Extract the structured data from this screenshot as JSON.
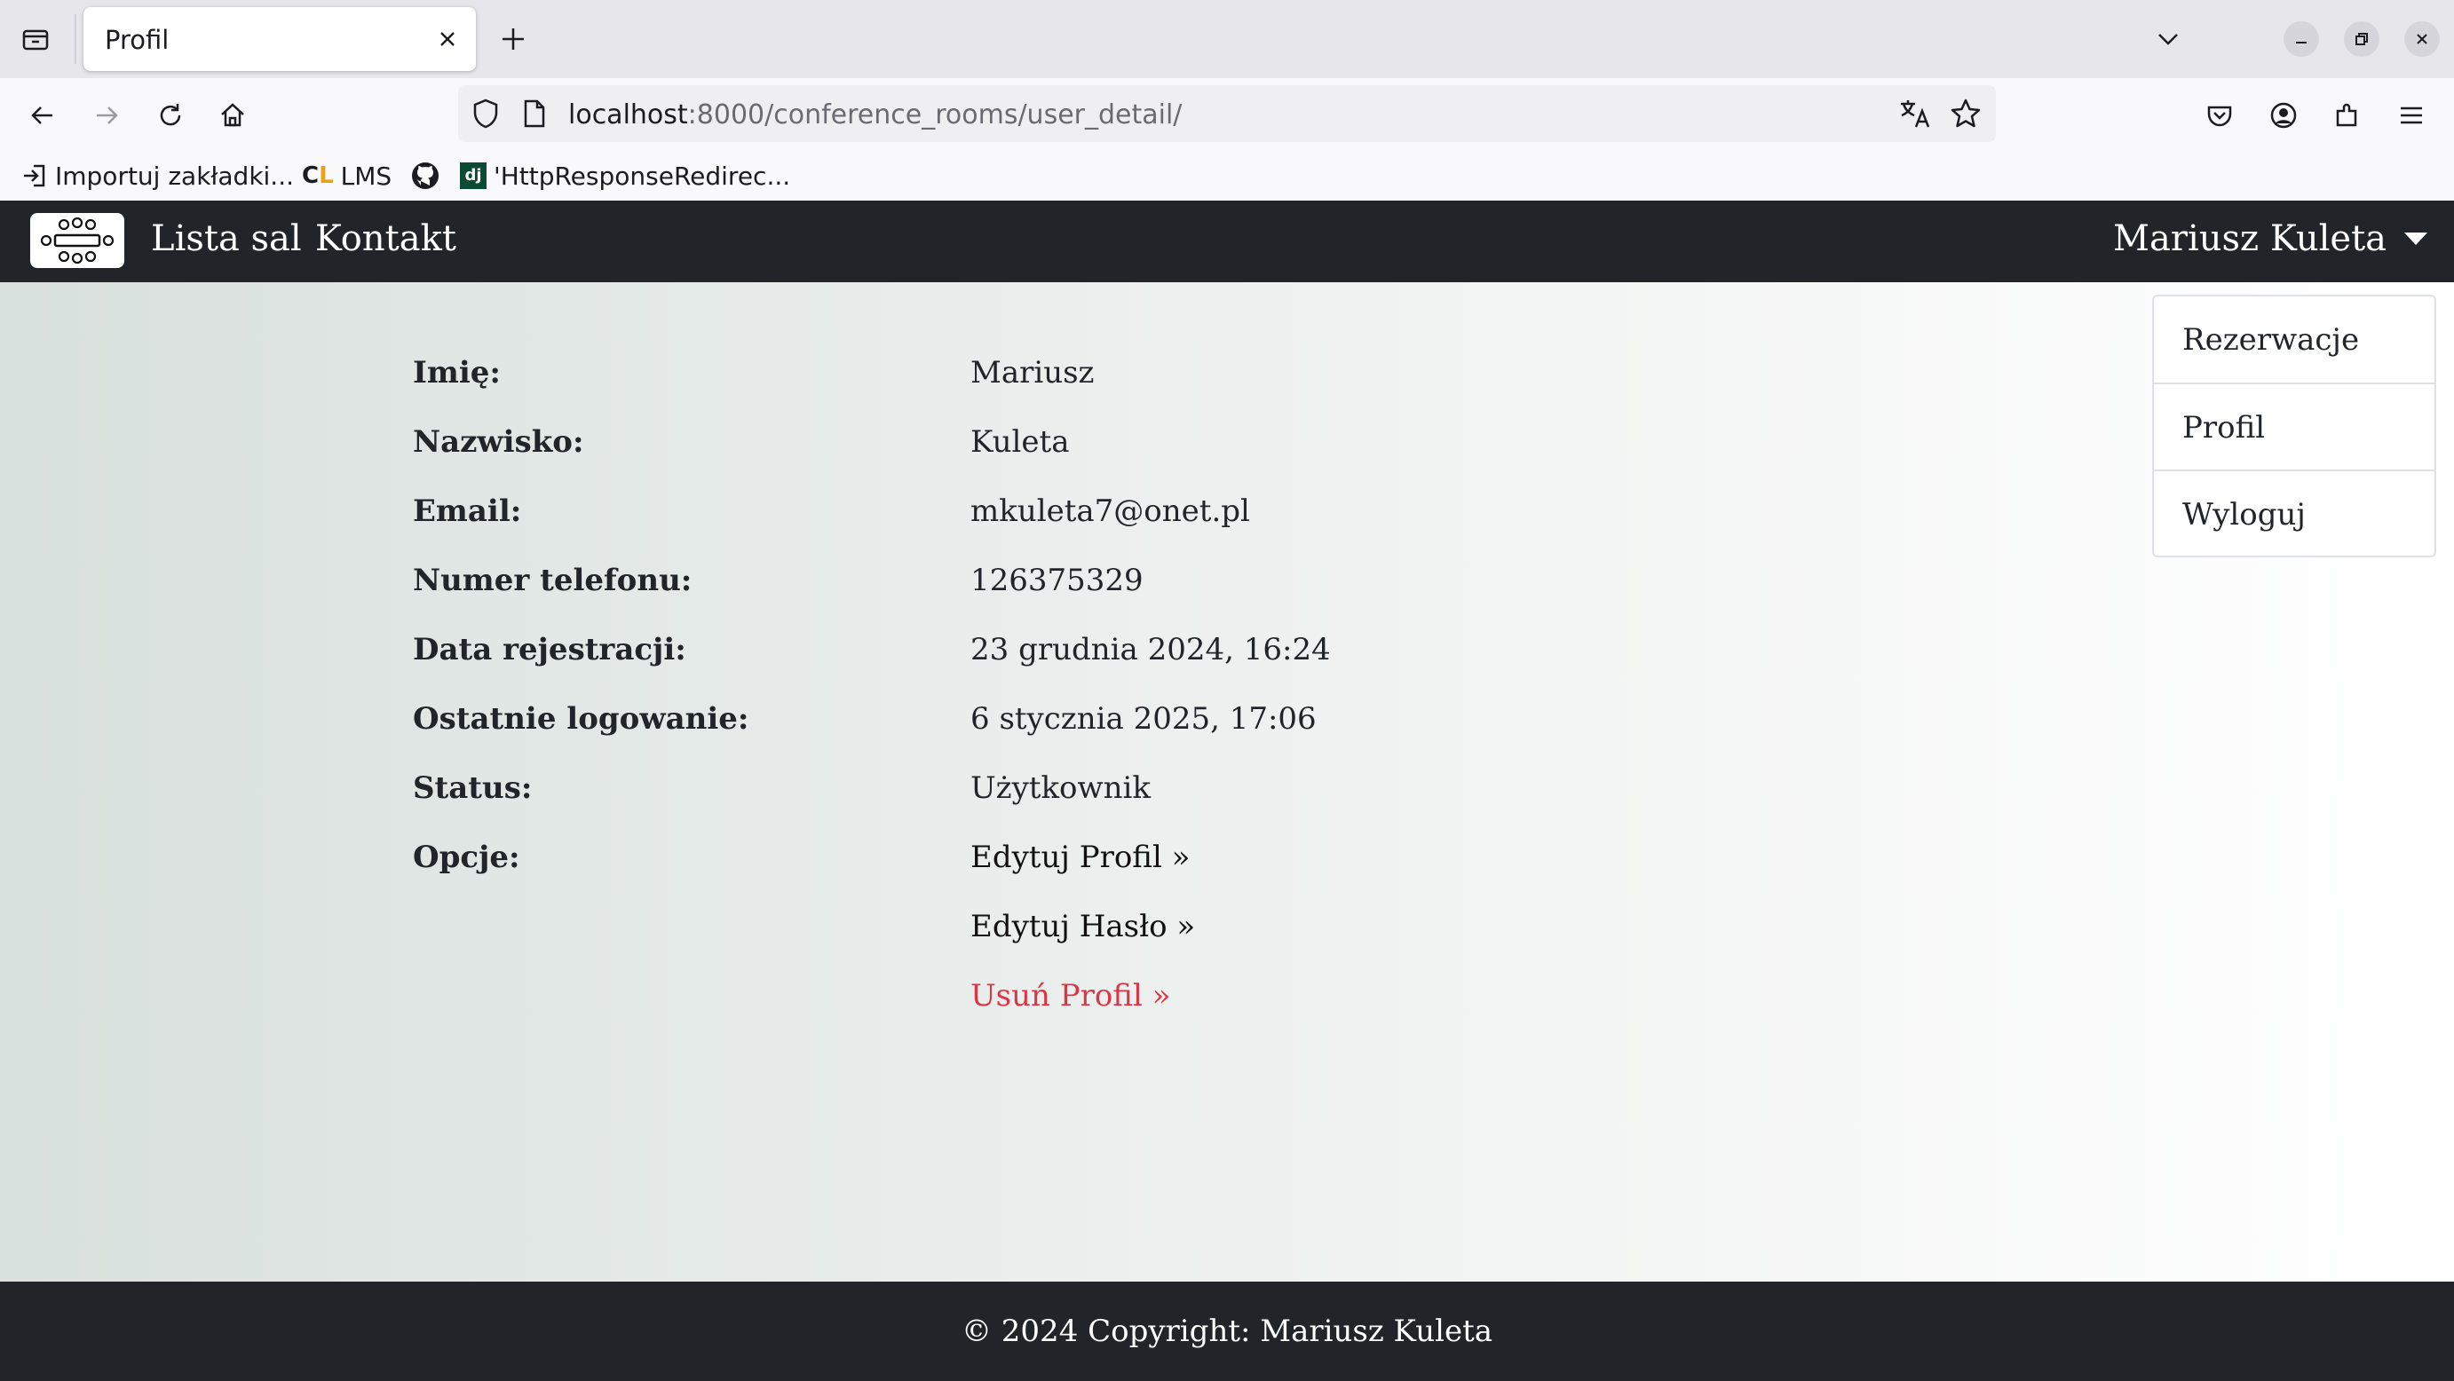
{
  "browser": {
    "tab_title": "Profil",
    "url_host": "localhost",
    "url_rest": ":8000/conference_rooms/user_detail/",
    "bookmarks": [
      "Importuj zakładki...",
      "LMS",
      "'HttpResponseRedirec..."
    ]
  },
  "site_nav": {
    "links": [
      "Lista sal",
      "Kontakt"
    ],
    "user_name": "Mariusz Kuleta"
  },
  "dropdown": {
    "items": [
      "Rezerwacje",
      "Profil",
      "Wyloguj"
    ]
  },
  "profile": {
    "fields": [
      {
        "label": "Imię:",
        "value": "Mariusz"
      },
      {
        "label": "Nazwisko:",
        "value": "Kuleta"
      },
      {
        "label": "Email:",
        "value": "mkuleta7@onet.pl"
      },
      {
        "label": "Numer telefonu:",
        "value": "126375329"
      },
      {
        "label": "Data rejestracji:",
        "value": "23 grudnia 2024, 16:24"
      },
      {
        "label": "Ostatnie logowanie:",
        "value": "6 stycznia 2025, 17:06"
      },
      {
        "label": "Status:",
        "value": "Użytkownik"
      }
    ],
    "options_label": "Opcje:",
    "options": [
      "Edytuj Profil »",
      "Edytuj Hasło »",
      "Usuń Profil »"
    ]
  },
  "footer": {
    "text": "© 2024 Copyright: Mariusz Kuleta"
  },
  "colors": {
    "navbar_bg": "#212529",
    "danger": "#dc3545"
  }
}
